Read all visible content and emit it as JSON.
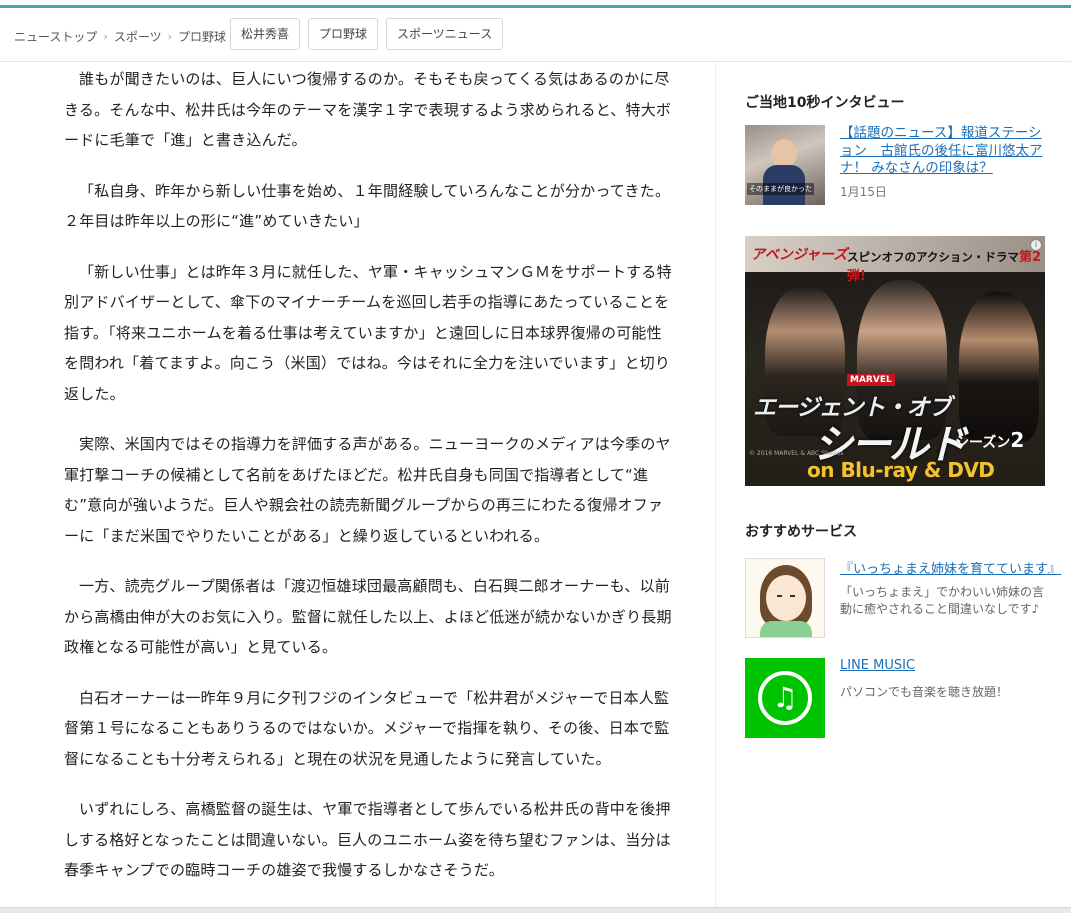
{
  "breadcrumb": {
    "items": [
      "ニューストップ",
      "スポーツ",
      "プロ野球"
    ],
    "separator": "›"
  },
  "tags": [
    "松井秀喜",
    "プロ野球",
    "スポーツニュース"
  ],
  "article": {
    "paragraphs": [
      "誰もが聞きたいのは、巨人にいつ復帰するのか。そもそも戻ってくる気はあるのかに尽きる。そんな中、松井氏は今年のテーマを漢字１字で表現するよう求められると、特大ボードに毛筆で「進」と書き込んだ。",
      "「私自身、昨年から新しい仕事を始め、１年間経験していろんなことが分かってきた。２年目は昨年以上の形に“進”めていきたい」",
      "「新しい仕事」とは昨年３月に就任した、ヤ軍・キャッシュマンＧＭをサポートする特別アドバイザーとして、傘下のマイナーチームを巡回し若手の指導にあたっていることを指す。「将来ユニホームを着る仕事は考えていますか」と遠回しに日本球界復帰の可能性を問われ「着てますよ。向こう（米国）ではね。今はそれに全力を注いでいます」と切り返した。",
      "実際、米国内ではその指導力を評価する声がある。ニューヨークのメディアは今季のヤ軍打撃コーチの候補として名前をあげたほどだ。松井氏自身も同国で指導者として“進む”意向が強いようだ。巨人や親会社の読売新聞グループからの再三にわたる復帰オファーに「まだ米国でやりたいことがある」と繰り返しているといわれる。",
      "一方、読売グループ関係者は「渡辺恒雄球団最高顧問も、白石興二郎オーナーも、以前から高橋由伸が大のお気に入り。監督に就任した以上、よほど低迷が続かないかぎり長期政権となる可能性が高い」と見ている。",
      "白石オーナーは一昨年９月に夕刊フジのインタビューで「松井君がメジャーで日本人監督第１号になることもありうるのではないか。メジャーで指揮を執り、その後、日本で監督になることも十分考えられる」と現在の状況を見通したように発言していた。",
      "いずれにしろ、高橋監督の誕生は、ヤ軍で指導者として歩んでいる松井氏の背中を後押しする格好となったことは間違いない。巨人のユニホーム姿を待ち望むファンは、当分は春季キャンプでの臨時コーチの雄姿で我慢するしかなさそうだ。"
    ]
  },
  "sidebar": {
    "interview": {
      "heading": "ご当地10秒インタビュー",
      "thumb_caption": "そのままが良かった",
      "title": "【話題のニュース】報道ステーション　古館氏の後任に富川悠太アナ！ みなさんの印象は？",
      "date": "1月15日"
    },
    "ad": {
      "brand": "アベンジャーズ",
      "tagline": "スピンオフのアクション・ドラマ",
      "tagline_strong": "第2弾!",
      "marvel": "MARVEL",
      "title_line1": "エージェント・オブ",
      "title_line2": "シールド",
      "season": "シーズン",
      "season_num": "2",
      "copyright": "© 2016 MARVEL & ABC Studios",
      "format": "on Blu-ray & DVD",
      "info_icon": "i"
    },
    "services": {
      "heading": "おすすめサービス",
      "items": [
        {
          "name": "『いっちょまえ姉妹を育てています』",
          "desc": "「いっちょまえ」でかわいい姉妹の言動に癒やされること間違いなしです♪",
          "icon": "girl-illustration-icon"
        },
        {
          "name": "LINE MUSIC",
          "desc": "パソコンでも音楽を聴き放題！",
          "icon": "music-note-icon",
          "glyph": "♫",
          "color": "#00c300"
        }
      ]
    }
  },
  "colors": {
    "accent_bar": "#4aa1b9",
    "link": "#1b6fb9",
    "line_green": "#00c300"
  }
}
